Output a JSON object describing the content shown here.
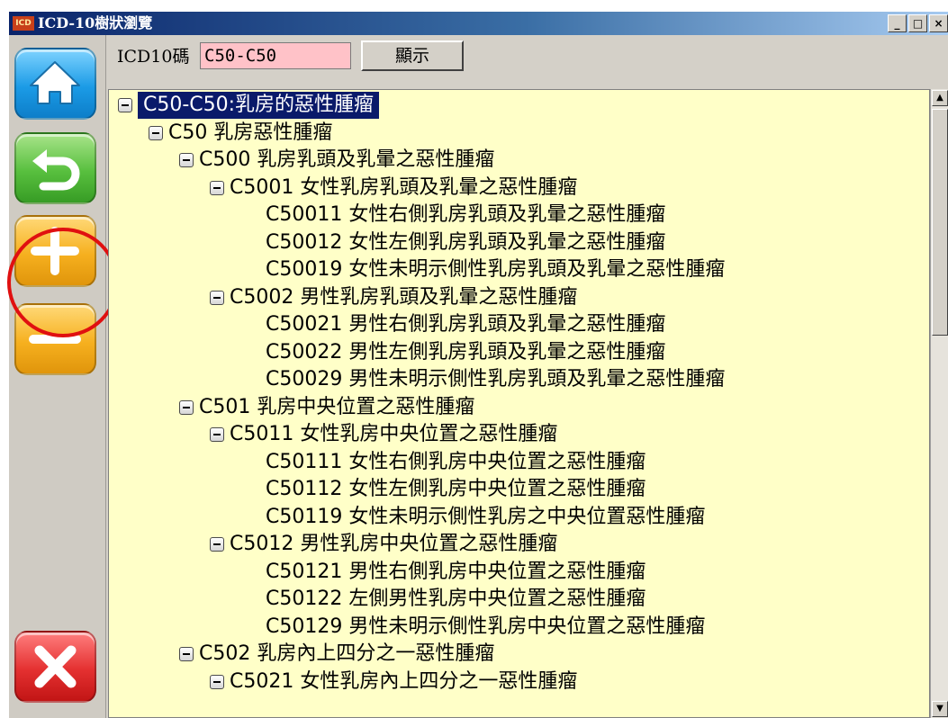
{
  "window": {
    "app_icon_text": "ICD",
    "title": "ICD-10樹狀瀏覽",
    "controls": {
      "minimize": "_",
      "maximize": "□",
      "close": "×"
    }
  },
  "search": {
    "label": "ICD10碼",
    "value": "C50-C50",
    "show_button": "顯示"
  },
  "sidebar": {
    "buttons": [
      {
        "name": "home",
        "icon": "home-icon",
        "color": "#1b9be6"
      },
      {
        "name": "back",
        "icon": "undo-arrow-icon",
        "color": "#58bf3e"
      },
      {
        "name": "expand",
        "icon": "plus-icon",
        "color": "#f6b01f",
        "highlighted": true,
        "highlight_color": "#e01010"
      },
      {
        "name": "collapse",
        "icon": "minus-icon",
        "color": "#f6b01f"
      },
      {
        "name": "close",
        "icon": "x-icon",
        "color": "#e43030"
      }
    ]
  },
  "tree": {
    "background": "#ffffc8",
    "nodes": [
      {
        "text": "C50-C50:乳房的惡性腫瘤",
        "level": 0,
        "expandable": true,
        "selected": true
      },
      {
        "text": "C50 乳房惡性腫瘤",
        "level": 1,
        "expandable": true
      },
      {
        "text": "C500 乳房乳頭及乳暈之惡性腫瘤",
        "level": 2,
        "expandable": true
      },
      {
        "text": "C5001 女性乳房乳頭及乳暈之惡性腫瘤",
        "level": 3,
        "expandable": true
      },
      {
        "text": "C50011 女性右側乳房乳頭及乳暈之惡性腫瘤",
        "level": 4,
        "expandable": false
      },
      {
        "text": "C50012 女性左側乳房乳頭及乳暈之惡性腫瘤",
        "level": 4,
        "expandable": false
      },
      {
        "text": "C50019 女性未明示側性乳房乳頭及乳暈之惡性腫瘤",
        "level": 4,
        "expandable": false
      },
      {
        "text": "C5002 男性乳房乳頭及乳暈之惡性腫瘤",
        "level": 3,
        "expandable": true
      },
      {
        "text": "C50021 男性右側乳房乳頭及乳暈之惡性腫瘤",
        "level": 4,
        "expandable": false
      },
      {
        "text": "C50022 男性左側乳房乳頭及乳暈之惡性腫瘤",
        "level": 4,
        "expandable": false
      },
      {
        "text": "C50029 男性未明示側性乳房乳頭及乳暈之惡性腫瘤",
        "level": 4,
        "expandable": false
      },
      {
        "text": "C501 乳房中央位置之惡性腫瘤",
        "level": 2,
        "expandable": true
      },
      {
        "text": "C5011 女性乳房中央位置之惡性腫瘤",
        "level": 3,
        "expandable": true
      },
      {
        "text": "C50111 女性右側乳房中央位置之惡性腫瘤",
        "level": 4,
        "expandable": false
      },
      {
        "text": "C50112 女性左側乳房中央位置之惡性腫瘤",
        "level": 4,
        "expandable": false
      },
      {
        "text": "C50119 女性未明示側性乳房之中央位置惡性腫瘤",
        "level": 4,
        "expandable": false
      },
      {
        "text": "C5012 男性乳房中央位置之惡性腫瘤",
        "level": 3,
        "expandable": true
      },
      {
        "text": "C50121 男性右側乳房中央位置之惡性腫瘤",
        "level": 4,
        "expandable": false
      },
      {
        "text": "C50122 左側男性乳房中央位置之惡性腫瘤",
        "level": 4,
        "expandable": false
      },
      {
        "text": "C50129 男性未明示側性乳房中央位置之惡性腫瘤",
        "level": 4,
        "expandable": false
      },
      {
        "text": "C502 乳房內上四分之一惡性腫瘤",
        "level": 2,
        "expandable": true
      },
      {
        "text": "C5021 女性乳房內上四分之一惡性腫瘤",
        "level": 3,
        "expandable": true
      }
    ]
  }
}
